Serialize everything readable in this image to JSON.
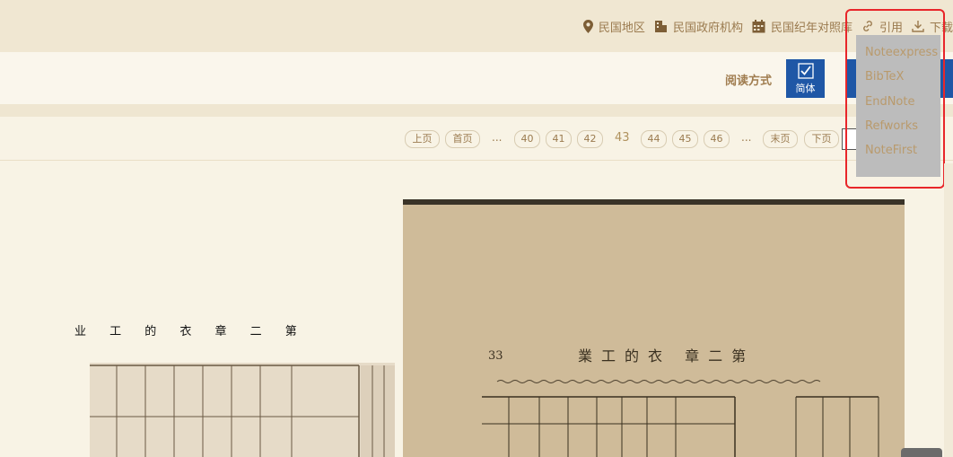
{
  "topnav": {
    "items": [
      {
        "label": "民国地区",
        "icon": "location-pin-icon"
      },
      {
        "label": "民国政府机构",
        "icon": "building-icon"
      },
      {
        "label": "民国纪年对照库",
        "icon": "calendar-icon"
      },
      {
        "label": "引用",
        "icon": "link-icon"
      },
      {
        "label": "下载",
        "icon": "download-icon"
      }
    ]
  },
  "toolbar": {
    "read_label": "阅读方式",
    "simplified_label": "简体"
  },
  "pager": {
    "prev": "上页",
    "first": "首页",
    "ellipsis": "...",
    "pages_before": [
      "40",
      "41",
      "42"
    ],
    "current": "43",
    "pages_after": [
      "44",
      "45",
      "46"
    ],
    "last": "末页",
    "next": "下页"
  },
  "cite_menu": {
    "items": [
      "Noteexpress",
      "BibTeX",
      "EndNote",
      "Refworks",
      "NoteFirst"
    ]
  },
  "content": {
    "chapter_title": "业 工 的 衣 章 二 第",
    "page_number": "33",
    "scan_heading": "業工的衣 章二第"
  },
  "colors": {
    "accent_blue": "#1f57a6",
    "text_brown": "#9a7a4e",
    "highlight_red": "#e8262a"
  }
}
